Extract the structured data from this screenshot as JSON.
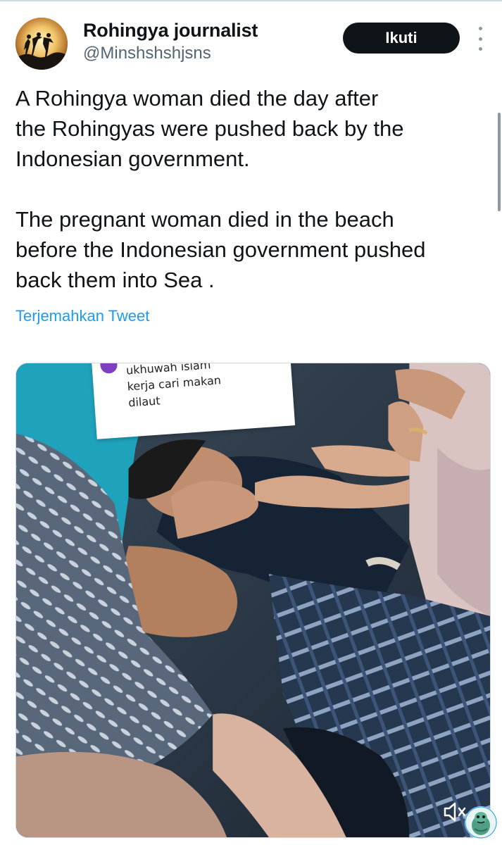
{
  "author": {
    "display_name": "Rohingya journalist",
    "handle": "@Minshshshjsns",
    "avatar_icon": "silhouette-avatar"
  },
  "header": {
    "follow_label": "Ikuti",
    "more_icon": "more-vertical-icon"
  },
  "tweet": {
    "text": "A Rohingya woman died the day after\nthe Rohingyas were pushed back by the\nIndonesian government.\n\nThe pregnant woman died in the beach\nbefore the Indonesian government pushed\nback them into Sea .",
    "translate_label": "Terjemahkan Tweet"
  },
  "media": {
    "type": "video",
    "caption_lines": [
      "ukhuwah islam",
      "kerja cari makan",
      "dilaut"
    ],
    "mute_icon": "speaker-muted-icon"
  },
  "colors": {
    "link": "#1d9bf0",
    "text": "#0f1419",
    "secondary": "#536471",
    "button_bg": "#0f1419"
  }
}
